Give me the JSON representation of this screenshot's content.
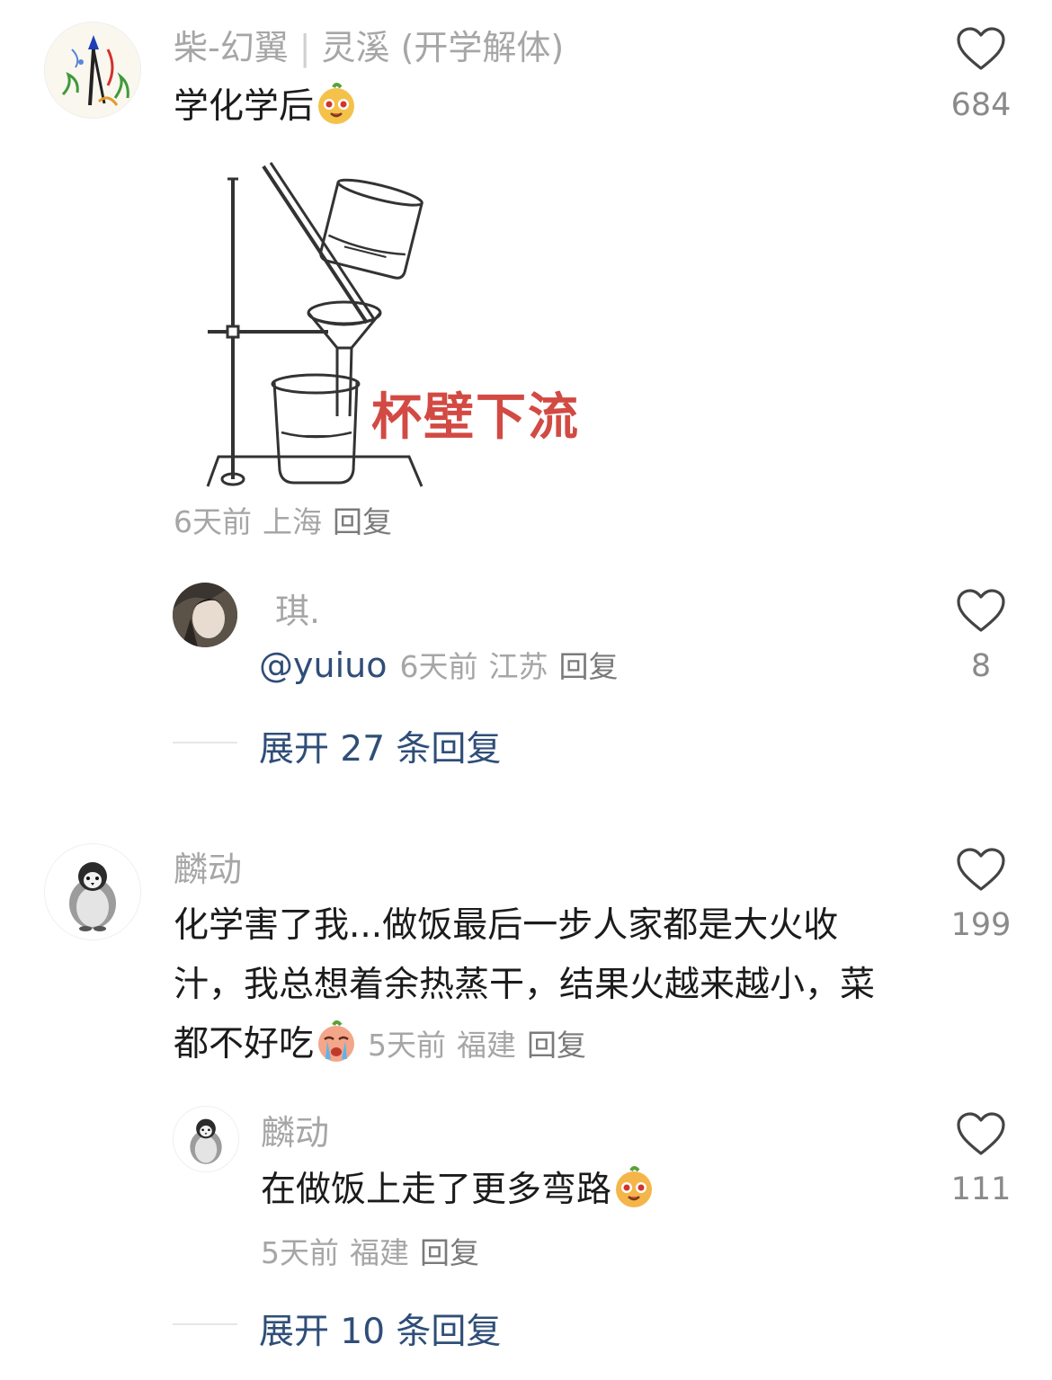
{
  "comments": [
    {
      "user": "柴-幻翼",
      "user_extra": "灵溪 (开学解体)",
      "text": "学化学后",
      "emoji": "sparkle-face-emoji",
      "image_caption": "杯壁下流",
      "time": "6天前",
      "location": "上海",
      "reply_label": "回复",
      "likes": "684",
      "sub_reply": {
        "user": "琪.",
        "mention": "@yuiuo",
        "time": "6天前",
        "location": "江苏",
        "reply_label": "回复",
        "likes": "8"
      },
      "expand_label": "展开 27 条回复"
    },
    {
      "user": "麟动",
      "text": "化学害了我...做饭最后一步人家都是大火收汁，我总想着余热蒸干，结果火越来越小，菜都不好吃",
      "emoji": "crying-face-emoji",
      "time": "5天前",
      "location": "福建",
      "reply_label": "回复",
      "likes": "199",
      "sub_reply": {
        "user": "麟动",
        "text": "在做饭上走了更多弯路",
        "emoji": "sparkle-face-emoji",
        "time": "5天前",
        "location": "福建",
        "reply_label": "回复",
        "likes": "111"
      },
      "expand_label": "展开 10 条回复"
    }
  ],
  "colors": {
    "username": "#a6a6a6",
    "text": "#1b1b1b",
    "link": "#2f4e78",
    "caption": "#d24a43"
  }
}
